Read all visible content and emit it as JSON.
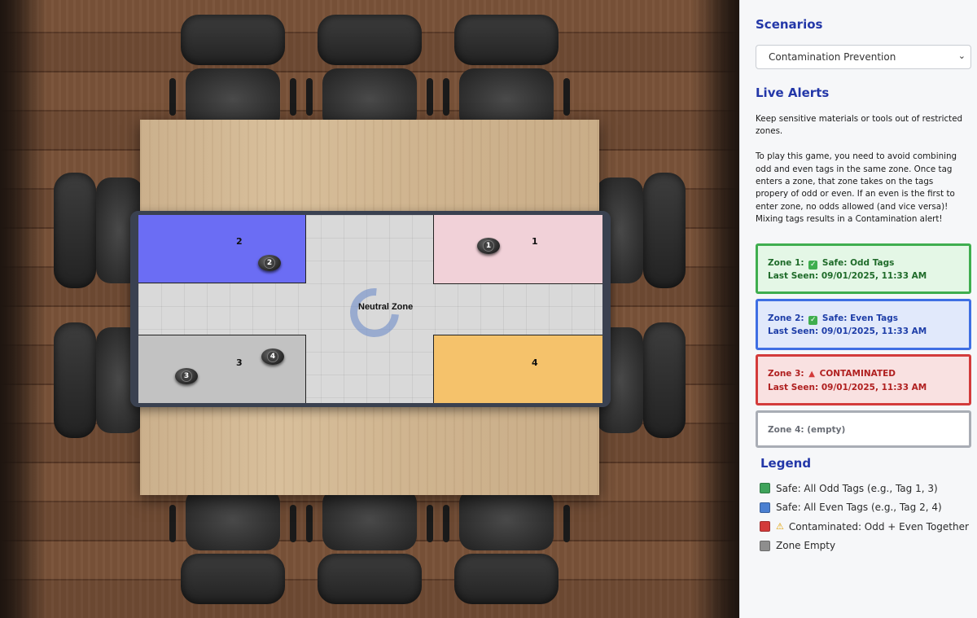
{
  "board": {
    "zones": [
      {
        "id": "zone-1",
        "label": "1"
      },
      {
        "id": "zone-2",
        "label": "2"
      },
      {
        "id": "zone-3",
        "label": "3"
      },
      {
        "id": "zone-4",
        "label": "4"
      }
    ],
    "neutral_label": "Neutral Zone",
    "tags": [
      "1",
      "2",
      "3",
      "4"
    ]
  },
  "panel": {
    "scenarios_title": "Scenarios",
    "scenario_selected": "Contamination Prevention",
    "live_alerts_title": "Live Alerts",
    "description": "Keep sensitive materials or tools out of restricted zones.\n\nTo play this game, you need to avoid combining odd and even tags in the same zone. Once tag enters a zone, that zone takes on the tags propery of odd or even. If an even is the first to enter zone, no odds allowed (and vice versa)! Mixing tags results in a Contamination alert!",
    "alerts": [
      {
        "zone": "Zone 1:",
        "icon": "check-icon",
        "status": "Safe: Odd Tags",
        "last_seen": "Last Seen: 09/01/2025, 11:33 AM"
      },
      {
        "zone": "Zone 2:",
        "icon": "check-icon",
        "status": "Safe: Even Tags",
        "last_seen": "Last Seen: 09/01/2025, 11:33 AM"
      },
      {
        "zone": "Zone 3:",
        "icon": "warning-icon",
        "status": "CONTAMINATED",
        "last_seen": "Last Seen: 09/01/2025, 11:33 AM"
      },
      {
        "zone": "Zone 4:",
        "status": "(empty)"
      }
    ],
    "legend_title": "Legend",
    "legend": [
      {
        "color": "#3fa35b",
        "text": "Safe: All Odd Tags (e.g., Tag 1, 3)"
      },
      {
        "color": "#4a7fd1",
        "text": "Safe: All Even Tags (e.g., Tag 2, 4)"
      },
      {
        "color": "#d33b3b",
        "icon": "warning-icon",
        "text": "Contaminated: Odd + Even Together"
      },
      {
        "color": "#8e8e8e",
        "text": "Zone Empty"
      }
    ]
  },
  "colors": {
    "accent": "#2337a8",
    "zone1": "#f1d1d8",
    "zone2": "#6b6df4",
    "zone3": "#c2c2c2",
    "zone4": "#f5c26b"
  }
}
